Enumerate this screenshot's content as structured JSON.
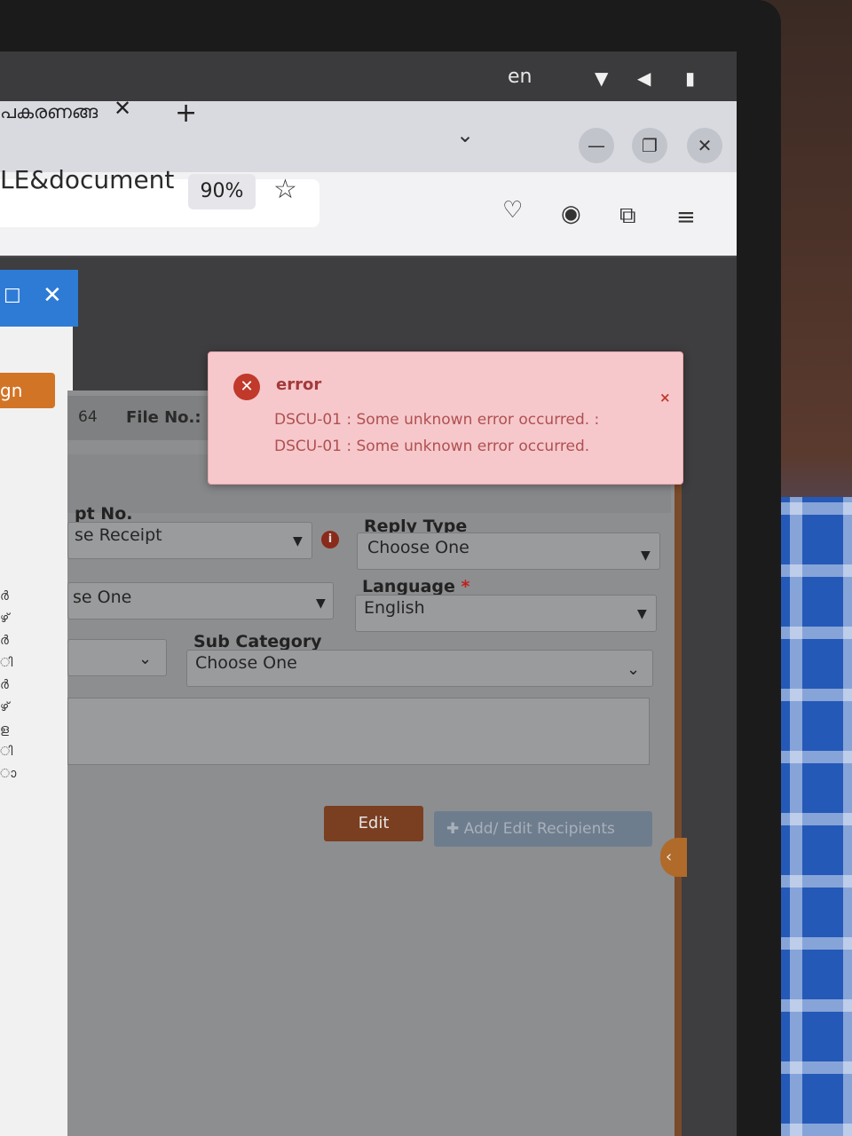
{
  "system_bar": {
    "language": "en",
    "icons": [
      "wifi-icon",
      "volume-icon",
      "battery-icon"
    ]
  },
  "browser": {
    "tab_title": "പകരണങ്ങ",
    "tab_close": "✕",
    "new_tab": "+",
    "tab_list": "⌄",
    "window_buttons": {
      "minimize": "—",
      "restore": "❐",
      "close": "✕"
    },
    "url_text": "LE&document",
    "zoom": "90%",
    "bookmark_star": "☆",
    "toolbar_icons": {
      "pocket": "♡",
      "account": "◉",
      "extensions": "⧉",
      "menu": "≡"
    }
  },
  "left_window": {
    "maximize": "☐",
    "close": "✕",
    "button_label": "gn",
    "glyphs": [
      "ർ",
      "ഴ്",
      "ർ",
      "ി",
      "ർ",
      "ഴ്",
      "ള",
      "ി",
      "ാ"
    ]
  },
  "form": {
    "file_no_prefix": "64",
    "file_no_label": "File No.:",
    "receipt_no_label": "pt No.",
    "receipt_no_value": "se Receipt",
    "reply_type_label": "Reply Type",
    "reply_type_value": "Choose One",
    "second_left_value": "se One",
    "language_label": "Language",
    "language_required": "*",
    "language_value": "English",
    "sub_category_label": "Sub Category",
    "sub_category_value": "Choose One",
    "edit_button": "Edit",
    "add_recipients_button": "Add/ Edit Recipients",
    "side_tab": "‹"
  },
  "error_toast": {
    "title": "error",
    "close": "×",
    "messages": [
      "DSCU-01 : Some unknown error occurred. :",
      "DSCU-01 : Some unknown error occurred."
    ]
  },
  "colors": {
    "toast_background": "#f6c8cc",
    "toast_text": "#b05050",
    "error_icon": "#c0392b",
    "edit_button": "#7a3e20",
    "left_accent_button": "#d27426",
    "left_titlebar": "#2e7bd6"
  }
}
